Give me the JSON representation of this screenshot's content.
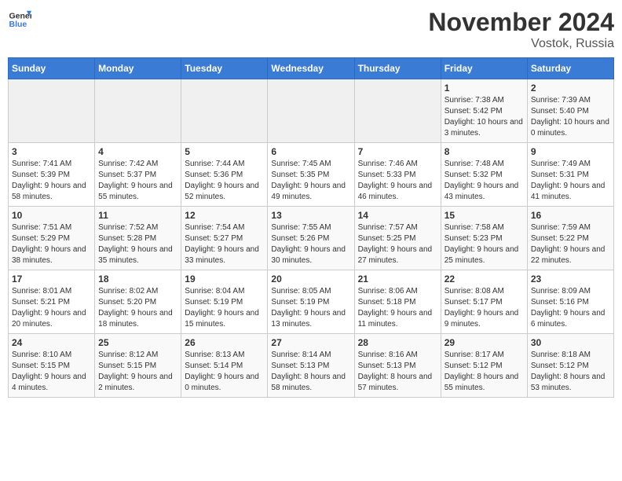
{
  "header": {
    "logo_general": "General",
    "logo_blue": "Blue",
    "month_title": "November 2024",
    "location": "Vostok, Russia"
  },
  "weekdays": [
    "Sunday",
    "Monday",
    "Tuesday",
    "Wednesday",
    "Thursday",
    "Friday",
    "Saturday"
  ],
  "weeks": [
    [
      {
        "day": "",
        "info": ""
      },
      {
        "day": "",
        "info": ""
      },
      {
        "day": "",
        "info": ""
      },
      {
        "day": "",
        "info": ""
      },
      {
        "day": "",
        "info": ""
      },
      {
        "day": "1",
        "info": "Sunrise: 7:38 AM\nSunset: 5:42 PM\nDaylight: 10 hours and 3 minutes."
      },
      {
        "day": "2",
        "info": "Sunrise: 7:39 AM\nSunset: 5:40 PM\nDaylight: 10 hours and 0 minutes."
      }
    ],
    [
      {
        "day": "3",
        "info": "Sunrise: 7:41 AM\nSunset: 5:39 PM\nDaylight: 9 hours and 58 minutes."
      },
      {
        "day": "4",
        "info": "Sunrise: 7:42 AM\nSunset: 5:37 PM\nDaylight: 9 hours and 55 minutes."
      },
      {
        "day": "5",
        "info": "Sunrise: 7:44 AM\nSunset: 5:36 PM\nDaylight: 9 hours and 52 minutes."
      },
      {
        "day": "6",
        "info": "Sunrise: 7:45 AM\nSunset: 5:35 PM\nDaylight: 9 hours and 49 minutes."
      },
      {
        "day": "7",
        "info": "Sunrise: 7:46 AM\nSunset: 5:33 PM\nDaylight: 9 hours and 46 minutes."
      },
      {
        "day": "8",
        "info": "Sunrise: 7:48 AM\nSunset: 5:32 PM\nDaylight: 9 hours and 43 minutes."
      },
      {
        "day": "9",
        "info": "Sunrise: 7:49 AM\nSunset: 5:31 PM\nDaylight: 9 hours and 41 minutes."
      }
    ],
    [
      {
        "day": "10",
        "info": "Sunrise: 7:51 AM\nSunset: 5:29 PM\nDaylight: 9 hours and 38 minutes."
      },
      {
        "day": "11",
        "info": "Sunrise: 7:52 AM\nSunset: 5:28 PM\nDaylight: 9 hours and 35 minutes."
      },
      {
        "day": "12",
        "info": "Sunrise: 7:54 AM\nSunset: 5:27 PM\nDaylight: 9 hours and 33 minutes."
      },
      {
        "day": "13",
        "info": "Sunrise: 7:55 AM\nSunset: 5:26 PM\nDaylight: 9 hours and 30 minutes."
      },
      {
        "day": "14",
        "info": "Sunrise: 7:57 AM\nSunset: 5:25 PM\nDaylight: 9 hours and 27 minutes."
      },
      {
        "day": "15",
        "info": "Sunrise: 7:58 AM\nSunset: 5:23 PM\nDaylight: 9 hours and 25 minutes."
      },
      {
        "day": "16",
        "info": "Sunrise: 7:59 AM\nSunset: 5:22 PM\nDaylight: 9 hours and 22 minutes."
      }
    ],
    [
      {
        "day": "17",
        "info": "Sunrise: 8:01 AM\nSunset: 5:21 PM\nDaylight: 9 hours and 20 minutes."
      },
      {
        "day": "18",
        "info": "Sunrise: 8:02 AM\nSunset: 5:20 PM\nDaylight: 9 hours and 18 minutes."
      },
      {
        "day": "19",
        "info": "Sunrise: 8:04 AM\nSunset: 5:19 PM\nDaylight: 9 hours and 15 minutes."
      },
      {
        "day": "20",
        "info": "Sunrise: 8:05 AM\nSunset: 5:19 PM\nDaylight: 9 hours and 13 minutes."
      },
      {
        "day": "21",
        "info": "Sunrise: 8:06 AM\nSunset: 5:18 PM\nDaylight: 9 hours and 11 minutes."
      },
      {
        "day": "22",
        "info": "Sunrise: 8:08 AM\nSunset: 5:17 PM\nDaylight: 9 hours and 9 minutes."
      },
      {
        "day": "23",
        "info": "Sunrise: 8:09 AM\nSunset: 5:16 PM\nDaylight: 9 hours and 6 minutes."
      }
    ],
    [
      {
        "day": "24",
        "info": "Sunrise: 8:10 AM\nSunset: 5:15 PM\nDaylight: 9 hours and 4 minutes."
      },
      {
        "day": "25",
        "info": "Sunrise: 8:12 AM\nSunset: 5:15 PM\nDaylight: 9 hours and 2 minutes."
      },
      {
        "day": "26",
        "info": "Sunrise: 8:13 AM\nSunset: 5:14 PM\nDaylight: 9 hours and 0 minutes."
      },
      {
        "day": "27",
        "info": "Sunrise: 8:14 AM\nSunset: 5:13 PM\nDaylight: 8 hours and 58 minutes."
      },
      {
        "day": "28",
        "info": "Sunrise: 8:16 AM\nSunset: 5:13 PM\nDaylight: 8 hours and 57 minutes."
      },
      {
        "day": "29",
        "info": "Sunrise: 8:17 AM\nSunset: 5:12 PM\nDaylight: 8 hours and 55 minutes."
      },
      {
        "day": "30",
        "info": "Sunrise: 8:18 AM\nSunset: 5:12 PM\nDaylight: 8 hours and 53 minutes."
      }
    ]
  ]
}
